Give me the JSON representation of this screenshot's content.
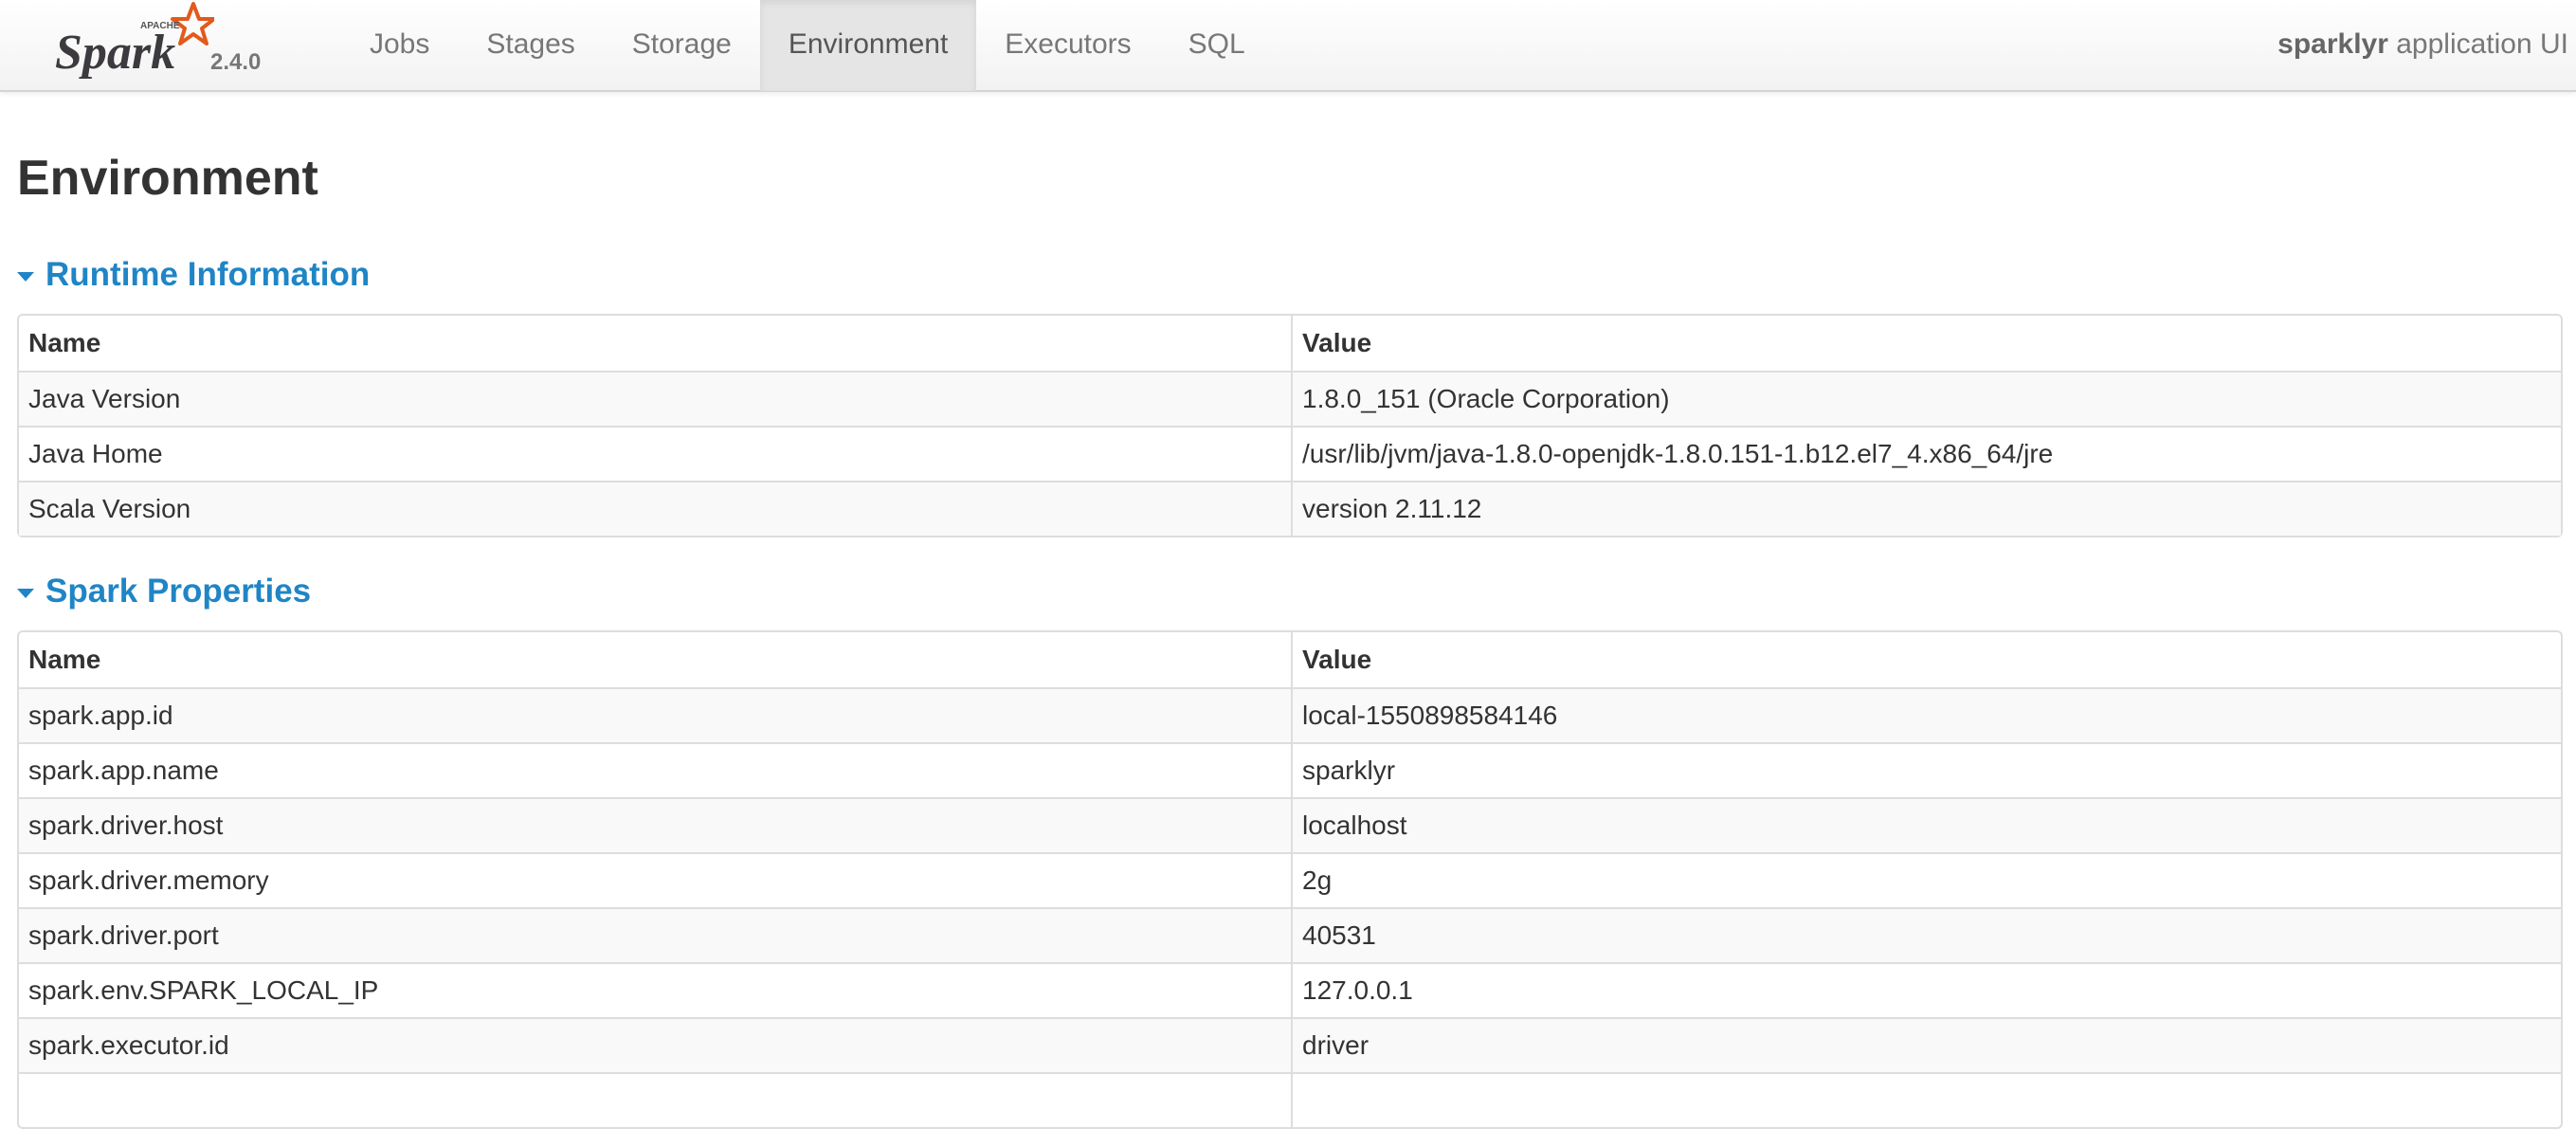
{
  "navbar": {
    "brand_logo_text": "Spark",
    "brand_super_text": "APACHE",
    "version": "2.4.0",
    "tabs": [
      {
        "label": "Jobs",
        "active": false
      },
      {
        "label": "Stages",
        "active": false
      },
      {
        "label": "Storage",
        "active": false
      },
      {
        "label": "Environment",
        "active": true
      },
      {
        "label": "Executors",
        "active": false
      },
      {
        "label": "SQL",
        "active": false
      }
    ],
    "app_name_bold": "sparklyr",
    "app_name_suffix": " application UI"
  },
  "page": {
    "title": "Environment"
  },
  "runtime": {
    "header": "Runtime Information",
    "columns": [
      "Name",
      "Value"
    ],
    "rows": [
      {
        "name": "Java Version",
        "value": "1.8.0_151 (Oracle Corporation)"
      },
      {
        "name": "Java Home",
        "value": "/usr/lib/jvm/java-1.8.0-openjdk-1.8.0.151-1.b12.el7_4.x86_64/jre"
      },
      {
        "name": "Scala Version",
        "value": "version 2.11.12"
      }
    ]
  },
  "spark_properties": {
    "header": "Spark Properties",
    "columns": [
      "Name",
      "Value"
    ],
    "rows": [
      {
        "name": "spark.app.id",
        "value": "local-1550898584146"
      },
      {
        "name": "spark.app.name",
        "value": "sparklyr"
      },
      {
        "name": "spark.driver.host",
        "value": "localhost"
      },
      {
        "name": "spark.driver.memory",
        "value": "2g"
      },
      {
        "name": "spark.driver.port",
        "value": "40531"
      },
      {
        "name": "spark.env.SPARK_LOCAL_IP",
        "value": "127.0.0.1"
      },
      {
        "name": "spark.executor.id",
        "value": "driver"
      },
      {
        "name": "",
        "value": ""
      }
    ]
  },
  "colors": {
    "accent": "#1f85c6",
    "logo_star": "#e25a1c",
    "text": "#333333"
  }
}
